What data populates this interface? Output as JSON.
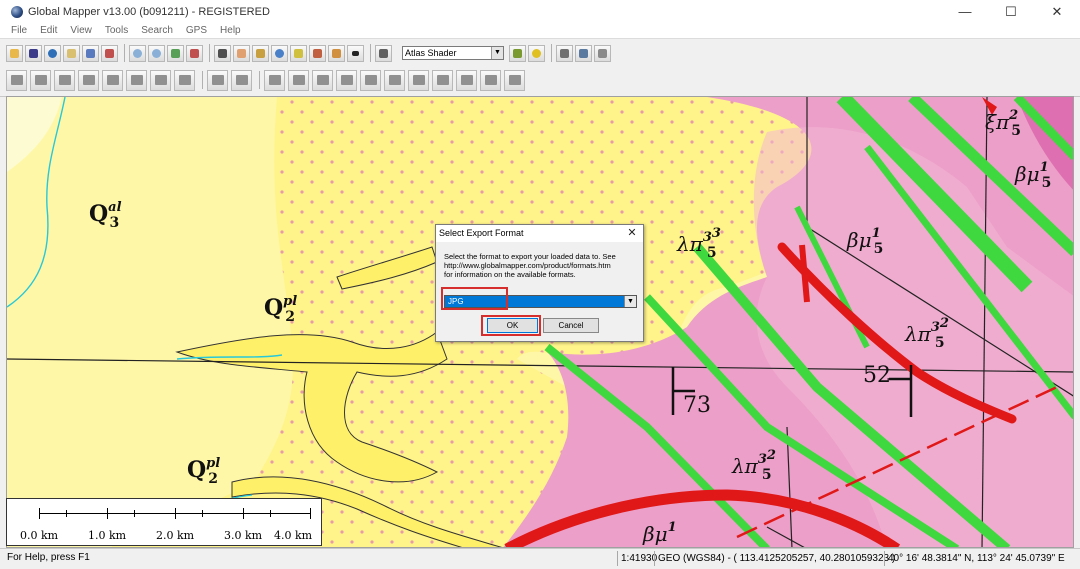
{
  "window": {
    "title": "Global Mapper v13.00 (b091211) - REGISTERED",
    "controls": {
      "minimize": "—",
      "maximize": "☐",
      "close": "✕"
    }
  },
  "menu": [
    "File",
    "Edit",
    "View",
    "Tools",
    "Search",
    "GPS",
    "Help"
  ],
  "toolbar": {
    "shader_select": {
      "value": "Atlas Shader",
      "arrow": "▼"
    }
  },
  "map": {
    "labels": {
      "q3": {
        "base": "Q",
        "sup": "al",
        "sub": "3"
      },
      "q2_mid": {
        "base": "Q",
        "sup": "pl",
        "sub": "2"
      },
      "q2_low": {
        "base": "Q",
        "sup": "pl",
        "sub": "2"
      },
      "lambda_top": {
        "greek": "λπ",
        "sup": "3",
        "supsup": "3",
        "sub": "5"
      },
      "beta_mid": {
        "greek": "βμ",
        "sup": "1",
        "sub": "5"
      },
      "lambda_right": {
        "greek": "λπ",
        "sup": "3",
        "supsup": "2",
        "sub": "5"
      },
      "xi_top": {
        "greek": "ξπ",
        "sup": "2",
        "sub": "5"
      },
      "beta_top": {
        "greek": "βμ",
        "sup": "1",
        "sub": "5"
      },
      "lambda_low": {
        "greek": "λπ",
        "sup": "3",
        "supsup": "2",
        "sub": "5"
      },
      "beta_bottom": {
        "greek": "βμ",
        "sup": "1",
        "sub": ""
      },
      "dip_73": "73",
      "dip_52": "52"
    }
  },
  "scale_bar": {
    "labels": [
      "0.0 km",
      "1.0 km",
      "2.0 km",
      "3.0 km",
      "4.0 km"
    ]
  },
  "dialog": {
    "title": "Select Export Format",
    "close": "✕",
    "message_lines": [
      "Select the format to export your loaded data to. See",
      "http://www.globalmapper.com/product/formats.htm",
      "for information on the available formats."
    ],
    "format_value": "JPG",
    "format_arrow": "▼",
    "ok_label": "OK",
    "cancel_label": "Cancel"
  },
  "status": {
    "help": "For Help, press F1",
    "scale": "1:41930",
    "projection": "GEO (WGS84) - ( 113.4125205257, 40.2801059323 )",
    "coords": "40° 16' 48.3814\" N, 113° 24' 45.0739\" E"
  },
  "colors": {
    "sand": "#fff7a8",
    "dotted_sand": "#fff48a",
    "pale": "#fdfbd2",
    "granite_pink": "#ec9fc8",
    "granite_light": "#f3b6d6",
    "dike_green": "#3fd83f",
    "dike_red": "#e01818",
    "highlight": "#d62d2d",
    "selection_blue": "#0078d7"
  }
}
